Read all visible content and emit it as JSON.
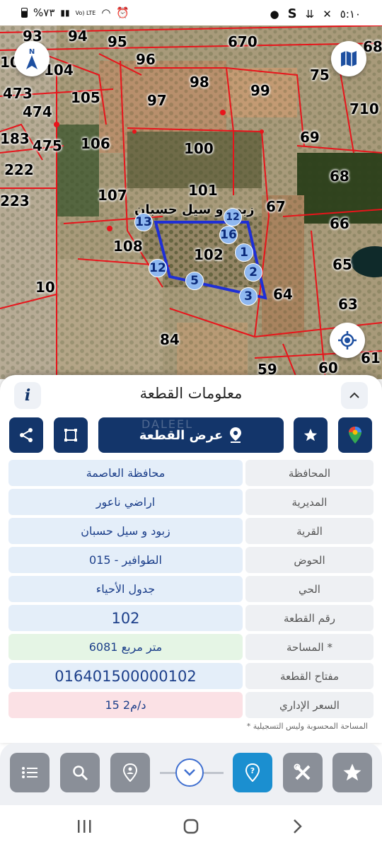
{
  "status_bar": {
    "battery": "%٧٣",
    "carrier": "Vo) LTE",
    "time": "٥:١٠",
    "extra": "S"
  },
  "map": {
    "parcels": [
      "93",
      "94",
      "95",
      "10",
      "104",
      "96",
      "670",
      "68",
      "473",
      "105",
      "97",
      "98",
      "99",
      "75",
      "474",
      "710",
      "183",
      "475",
      "106",
      "100",
      "69",
      "222",
      "107",
      "101",
      "68",
      "223",
      "67",
      "13",
      "12",
      "16",
      "66",
      "108",
      "1",
      "102",
      "12",
      "2",
      "65",
      "10",
      "5",
      "3",
      "64",
      "63",
      "84",
      "59",
      "60",
      "61"
    ],
    "vertices": [
      "13",
      "12",
      "16",
      "1",
      "12",
      "2",
      "5",
      "3"
    ],
    "village_label": "زبود و سيل حسبان"
  },
  "sheet": {
    "title": "معلومات القطعة",
    "info_icon": "i",
    "show_parcel_label": "عرض القطعة",
    "watermark": "DALEEL",
    "rows": [
      {
        "label": "المحافظة",
        "value": "محافظة العاصمة"
      },
      {
        "label": "المديرية",
        "value": "اراضي ناعور"
      },
      {
        "label": "القرية",
        "value": "زبود و سيل حسبان"
      },
      {
        "label": "الحوض",
        "value": "الطوافير - 015"
      },
      {
        "label": "الحي",
        "value": "جدول الأحياء"
      },
      {
        "label": "رقم القطعة",
        "value": "102"
      },
      {
        "label": "المساحة *",
        "value": "6081 متر مربع"
      },
      {
        "label": "مفتاح القطعة",
        "value": "016401500000102"
      },
      {
        "label": "السعر الإداري",
        "value": "15 د/م2"
      }
    ],
    "note": "* المساحة المحسوبة وليس التسجيلية"
  },
  "icons": [
    "compass-icon",
    "map-layers-icon",
    "locate-icon",
    "info-icon",
    "chevron-up-icon",
    "share-icon",
    "polygon-icon",
    "pin-icon",
    "star-icon",
    "google-maps-icon",
    "list-icon",
    "search-icon",
    "person-pin-icon",
    "chevron-down-icon",
    "help-pin-icon",
    "tools-icon",
    "favorite-icon",
    "recents-icon",
    "home-icon",
    "back-icon"
  ],
  "colors": {
    "primary": "#13356a",
    "accent": "#1b8fd0",
    "parcel_line": "#e8141b",
    "selected_parcel": "#1f2fd6"
  }
}
